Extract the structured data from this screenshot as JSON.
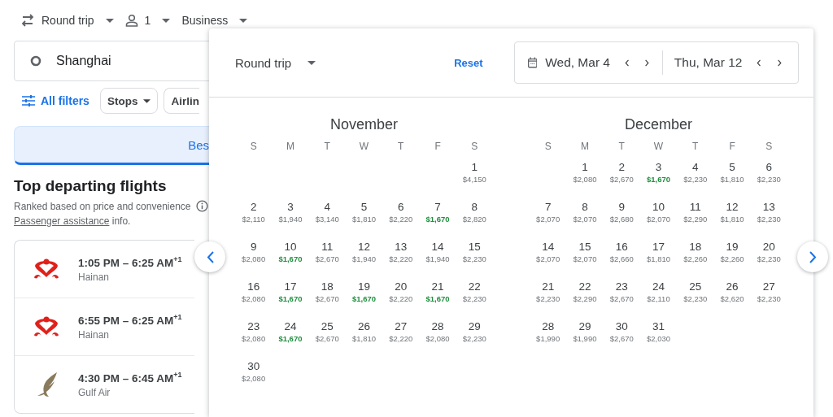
{
  "top_bar": {
    "trip_type": "Round trip",
    "passengers": "1",
    "cabin": "Business"
  },
  "search": {
    "origin": "Shanghai"
  },
  "filters": {
    "all_filters": "All filters",
    "chips": [
      "Stops",
      "Airlin"
    ]
  },
  "sort_tab": {
    "label": "Bes"
  },
  "section": {
    "title": "Top departing flights",
    "subtitle": "Ranked based on price and convenience",
    "link": "Passenger assistance",
    "link_suffix": " info."
  },
  "flights": [
    {
      "times": "1:05 PM – 6:25 AM",
      "day_offset": "+1",
      "airline": "Hainan",
      "kind": "emblem"
    },
    {
      "times": "6:55 PM – 6:25 AM",
      "day_offset": "+1",
      "airline": "Hainan",
      "kind": "emblem"
    },
    {
      "times": "4:30 PM – 6:45 AM",
      "day_offset": "+1",
      "airline": "Gulf Air",
      "kind": "bird"
    }
  ],
  "date_picker": {
    "trip_type": "Round trip",
    "reset": "Reset",
    "departure": "Wed, Mar 4",
    "return": "Thu, Mar 12",
    "months": [
      {
        "name": "November",
        "weekdays": [
          "S",
          "M",
          "T",
          "W",
          "T",
          "F",
          "S"
        ],
        "weeks": [
          [
            {
              "day": "1",
              "price": "$4,150",
              "lowest": false
            }
          ],
          [
            {
              "day": "2",
              "price": "$2,110",
              "lowest": false
            },
            {
              "day": "3",
              "price": "$1,940",
              "lowest": false
            },
            {
              "day": "4",
              "price": "$3,140",
              "lowest": false
            },
            {
              "day": "5",
              "price": "$1,810",
              "lowest": false
            },
            {
              "day": "6",
              "price": "$2,220",
              "lowest": false
            },
            {
              "day": "7",
              "price": "$1,670",
              "lowest": true
            },
            {
              "day": "8",
              "price": "$2,820",
              "lowest": false
            }
          ],
          [
            {
              "day": "9",
              "price": "$2,080",
              "lowest": false
            },
            {
              "day": "10",
              "price": "$1,670",
              "lowest": true
            },
            {
              "day": "11",
              "price": "$2,670",
              "lowest": false
            },
            {
              "day": "12",
              "price": "$1,940",
              "lowest": false
            },
            {
              "day": "13",
              "price": "$2,220",
              "lowest": false
            },
            {
              "day": "14",
              "price": "$1,940",
              "lowest": false
            },
            {
              "day": "15",
              "price": "$2,230",
              "lowest": false
            }
          ],
          [
            {
              "day": "16",
              "price": "$2,080",
              "lowest": false
            },
            {
              "day": "17",
              "price": "$1,670",
              "lowest": true
            },
            {
              "day": "18",
              "price": "$2,670",
              "lowest": false
            },
            {
              "day": "19",
              "price": "$1,670",
              "lowest": true
            },
            {
              "day": "20",
              "price": "$2,220",
              "lowest": false
            },
            {
              "day": "21",
              "price": "$1,670",
              "lowest": true
            },
            {
              "day": "22",
              "price": "$2,230",
              "lowest": false
            }
          ],
          [
            {
              "day": "23",
              "price": "$2,080",
              "lowest": false
            },
            {
              "day": "24",
              "price": "$1,670",
              "lowest": true
            },
            {
              "day": "25",
              "price": "$2,670",
              "lowest": false
            },
            {
              "day": "26",
              "price": "$1,810",
              "lowest": false
            },
            {
              "day": "27",
              "price": "$2,220",
              "lowest": false
            },
            {
              "day": "28",
              "price": "$2,080",
              "lowest": false
            },
            {
              "day": "29",
              "price": "$2,230",
              "lowest": false
            }
          ],
          [
            {
              "day": "30",
              "price": "$2,080",
              "lowest": false
            }
          ]
        ]
      },
      {
        "name": "December",
        "weekdays": [
          "S",
          "M",
          "T",
          "W",
          "T",
          "F",
          "S"
        ],
        "weeks": [
          [
            {
              "day": "1",
              "price": "$2,080",
              "lowest": false
            },
            {
              "day": "2",
              "price": "$2,670",
              "lowest": false
            },
            {
              "day": "3",
              "price": "$1,670",
              "lowest": true
            },
            {
              "day": "4",
              "price": "$2,230",
              "lowest": false
            },
            {
              "day": "5",
              "price": "$1,810",
              "lowest": false
            },
            {
              "day": "6",
              "price": "$2,230",
              "lowest": false
            }
          ],
          [
            {
              "day": "7",
              "price": "$2,070",
              "lowest": false
            },
            {
              "day": "8",
              "price": "$2,070",
              "lowest": false
            },
            {
              "day": "9",
              "price": "$2,680",
              "lowest": false
            },
            {
              "day": "10",
              "price": "$2,070",
              "lowest": false
            },
            {
              "day": "11",
              "price": "$2,290",
              "lowest": false
            },
            {
              "day": "12",
              "price": "$1,810",
              "lowest": false
            },
            {
              "day": "13",
              "price": "$2,230",
              "lowest": false
            }
          ],
          [
            {
              "day": "14",
              "price": "$2,070",
              "lowest": false
            },
            {
              "day": "15",
              "price": "$2,070",
              "lowest": false
            },
            {
              "day": "16",
              "price": "$2,660",
              "lowest": false
            },
            {
              "day": "17",
              "price": "$1,810",
              "lowest": false
            },
            {
              "day": "18",
              "price": "$2,260",
              "lowest": false
            },
            {
              "day": "19",
              "price": "$2,260",
              "lowest": false
            },
            {
              "day": "20",
              "price": "$2,230",
              "lowest": false
            }
          ],
          [
            {
              "day": "21",
              "price": "$2,230",
              "lowest": false
            },
            {
              "day": "22",
              "price": "$2,290",
              "lowest": false
            },
            {
              "day": "23",
              "price": "$2,670",
              "lowest": false
            },
            {
              "day": "24",
              "price": "$2,110",
              "lowest": false
            },
            {
              "day": "25",
              "price": "$2,230",
              "lowest": false
            },
            {
              "day": "26",
              "price": "$2,620",
              "lowest": false
            },
            {
              "day": "27",
              "price": "$2,230",
              "lowest": false
            }
          ],
          [
            {
              "day": "28",
              "price": "$1,990",
              "lowest": false
            },
            {
              "day": "29",
              "price": "$1,990",
              "lowest": false
            },
            {
              "day": "30",
              "price": "$2,670",
              "lowest": false
            },
            {
              "day": "31",
              "price": "$2,030",
              "lowest": false
            }
          ]
        ]
      }
    ]
  }
}
